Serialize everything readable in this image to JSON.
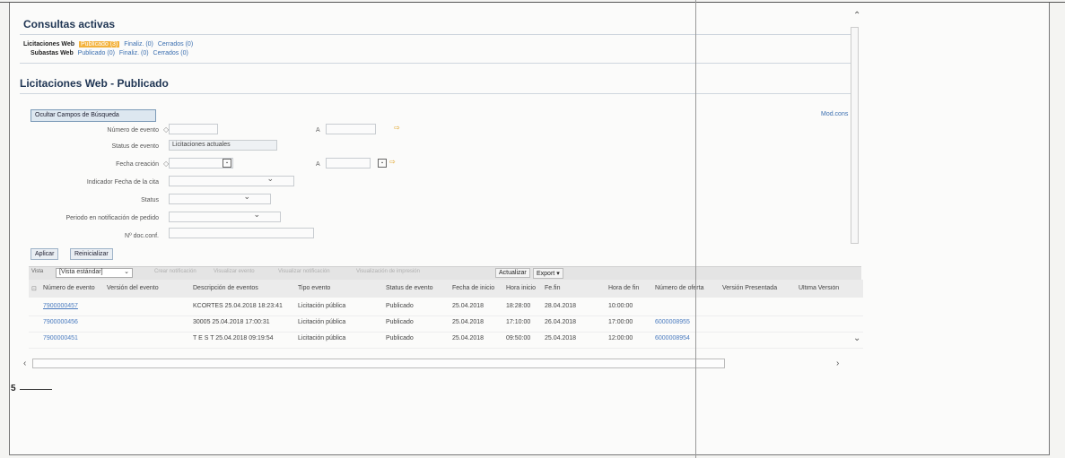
{
  "header": {
    "consultas_title": "Consultas activas",
    "licitaciones_label": "Licitaciones Web",
    "licitaciones_links": [
      "Publicado (3)",
      "Finaliz. (0)",
      "Cerrados (0)"
    ],
    "subastas_label": "Subastas Web",
    "subastas_links": [
      "Publicado (0)",
      "Finaliz. (0)",
      "Cerrados (0)"
    ],
    "section_title": "Licitaciones Web - Publicado"
  },
  "search": {
    "hide_button": "Ocultar Campos de Búsqueda",
    "right_link": "Mod.cons",
    "a_label": "A",
    "fields": {
      "numero_evento": "Número de evento",
      "status_evento": "Status de evento",
      "status_evento_value": "Licitaciones actuales",
      "fecha_creacion": "Fecha creación",
      "indicador_fecha": "Indicador Fecha de la cita",
      "status": "Status",
      "periodo": "Periodo en notificación de pedido",
      "doc_conf": "Nº doc.conf."
    },
    "apply_button": "Aplicar",
    "reset_button": "Reinicializar"
  },
  "toolbar": {
    "vista_label": "Vista",
    "vista_value": "[Vista estándar]",
    "items": [
      "Crear notificación",
      "Visualizar evento",
      "Visualizar notificación",
      "Visualización de impresión"
    ],
    "actualizar": "Actualizar",
    "export": "Export"
  },
  "table": {
    "columns": [
      "Número de evento",
      "Versión del evento",
      "Descripción de eventos",
      "Tipo evento",
      "Status de evento",
      "Fecha de inicio",
      "Hora inicio",
      "Fe.fin",
      "Hora de fin",
      "Número de oferta",
      "Versión Presentada",
      "Última Versión"
    ],
    "rows": [
      [
        "7900000457",
        "",
        "KCORTES 25.04.2018 18:23:41",
        "Licitación pública",
        "Publicado",
        "25.04.2018",
        "18:28:00",
        "28.04.2018",
        "10:00:00",
        "",
        "",
        ""
      ],
      [
        "7900000456",
        "",
        "30005 25.04.2018 17:00:31",
        "Licitación pública",
        "Publicado",
        "25.04.2018",
        "17:10:00",
        "26.04.2018",
        "17:00:00",
        "6000008955",
        "",
        ""
      ],
      [
        "7900000451",
        "",
        "T E S T 25.04.2018 09:19:54",
        "Licitación pública",
        "Publicado",
        "25.04.2018",
        "09:50:00",
        "25.04.2018",
        "12:00:00",
        "6000008954",
        "",
        ""
      ]
    ]
  },
  "page_number": "5"
}
